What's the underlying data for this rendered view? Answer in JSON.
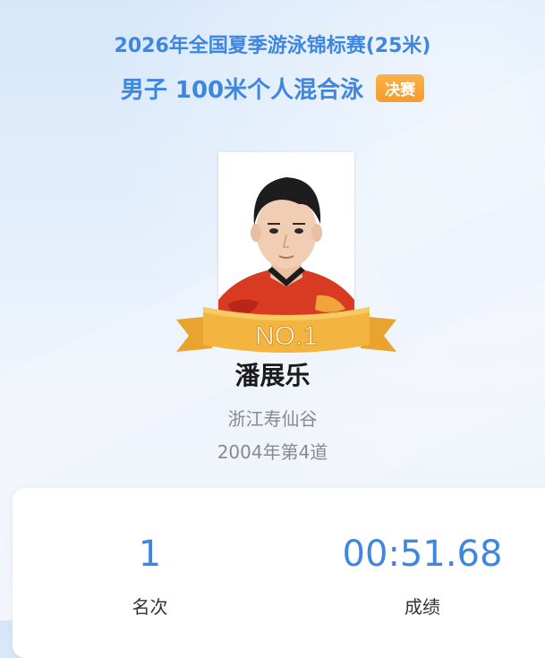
{
  "event": {
    "competition": "2026年全国夏季游泳锦标赛(25米)",
    "event_name": "男子 100米个人混合泳",
    "stage_badge": "决赛"
  },
  "athlete": {
    "rank_ribbon": "NO.1",
    "name": "潘展乐",
    "team": "浙江寿仙谷",
    "birth_lane": "2004年第4道"
  },
  "result": {
    "rank_value": "1",
    "rank_label": "名次",
    "time_value": "00:51.68",
    "time_label": "成绩"
  },
  "colors": {
    "accent": "#3f86e0",
    "badge": "#f59b2a",
    "ribbon": "#f3b53f"
  }
}
